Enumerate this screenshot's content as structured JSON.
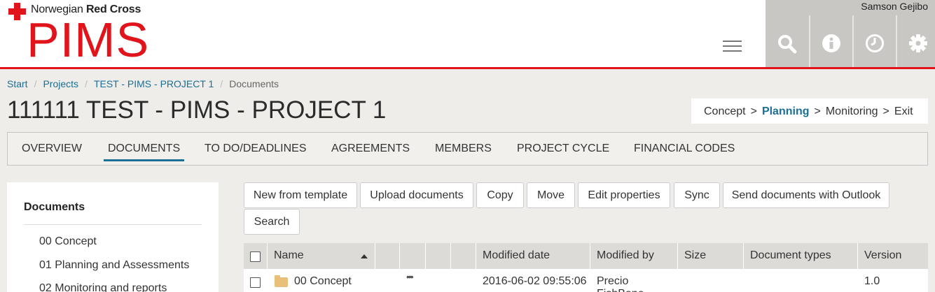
{
  "header": {
    "org_prefix": "Norwegian ",
    "org_bold": "Red Cross",
    "app_name": "PIMS",
    "user_name": "Samson Gejibo",
    "tools": [
      "search-icon",
      "info-icon",
      "clock-icon",
      "gear-icon"
    ]
  },
  "breadcrumb": {
    "items": [
      "Start",
      "Projects",
      "TEST - PIMS - PROJECT 1"
    ],
    "current": "Documents",
    "separator": "/"
  },
  "page": {
    "title": "111111 TEST - PIMS - PROJECT 1"
  },
  "phases": {
    "items": [
      "Concept",
      "Planning",
      "Monitoring",
      "Exit"
    ],
    "active": "Planning",
    "separator": ">"
  },
  "tabs": {
    "items": [
      "OVERVIEW",
      "DOCUMENTS",
      "TO DO/DEADLINES",
      "AGREEMENTS",
      "MEMBERS",
      "PROJECT CYCLE",
      "FINANCIAL CODES"
    ],
    "active": "DOCUMENTS"
  },
  "sidebar": {
    "title": "Documents",
    "items": [
      "00 Concept",
      "01 Planning and Assessments",
      "02 Monitoring and reports"
    ]
  },
  "toolbar": {
    "buttons": [
      "New from template",
      "Upload documents",
      "Copy",
      "Move",
      "Edit properties",
      "Sync",
      "Send documents with Outlook",
      "Search"
    ]
  },
  "table": {
    "columns": [
      "Name",
      "Modified date",
      "Modified by",
      "Size",
      "Document types",
      "Version"
    ],
    "sort_column": "Name",
    "sort_dir": "asc",
    "rows": [
      {
        "name": "00 Concept",
        "menu": "•••",
        "modified_date": "2016-06-02 09:55:06",
        "modified_by": "Precio FishBone",
        "size": "",
        "document_types": "",
        "version": "1.0"
      }
    ]
  },
  "colors": {
    "brand_red": "#e1141c",
    "link_blue": "#1b6f97",
    "toolbar_gray": "#c8c7c3"
  }
}
